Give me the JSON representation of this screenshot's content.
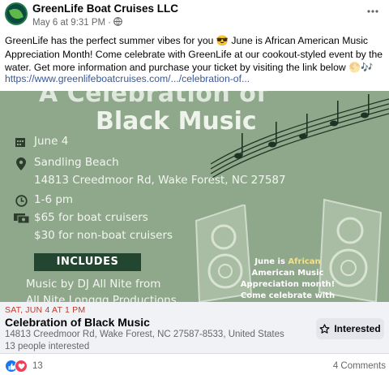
{
  "post": {
    "page_name": "GreenLife Boat Cruises LLC",
    "timestamp": "May 6 at 9:31 PM",
    "separator": "·",
    "text": "GreenLife has the perfect summer vibes for you 😎 June is African American Music Appreciation Month! Come celebrate with GreenLife at our cookout-styled event by the water. Get more information and purchase your ticket by visiting the link below 🌕🎶",
    "link": "https://www.greenlifeboatcruises.com/.../celebration-of..."
  },
  "flyer": {
    "title_line1": "A Celebration of",
    "title_line2": "Black Music",
    "date": "June 4",
    "location": "Sandling Beach",
    "address": "14813 Creedmoor Rd, Wake Forest, NC 27587",
    "time": "1-6 pm",
    "price_boat": "$65 for boat cruisers",
    "price_nonboat": "$30 for non-boat cruisers",
    "includes_label": "INCLUDES",
    "include_1": "Music by DJ All Nite from",
    "include_2": "All Nite Longgg Productions",
    "right_text_a": "June is ",
    "right_text_b": "African",
    "right_text_c": "American Music",
    "right_text_d": "Appreciation month!",
    "right_text_e": "Come celebrate with"
  },
  "event": {
    "date": "SAT, JUN 4 AT 1 PM",
    "title": "Celebration of Black Music",
    "address": "14813 Creedmoor Rd, Wake Forest, NC 27587-8533, United States",
    "interest": "13 people interested",
    "button_label": "Interested"
  },
  "footer": {
    "reaction_count": "13",
    "comments": "4 Comments"
  },
  "colors": {
    "accent": "#1877f2",
    "love": "#f33e58",
    "flyer_bg": "#8fa78a",
    "event_date": "#c0392b"
  }
}
